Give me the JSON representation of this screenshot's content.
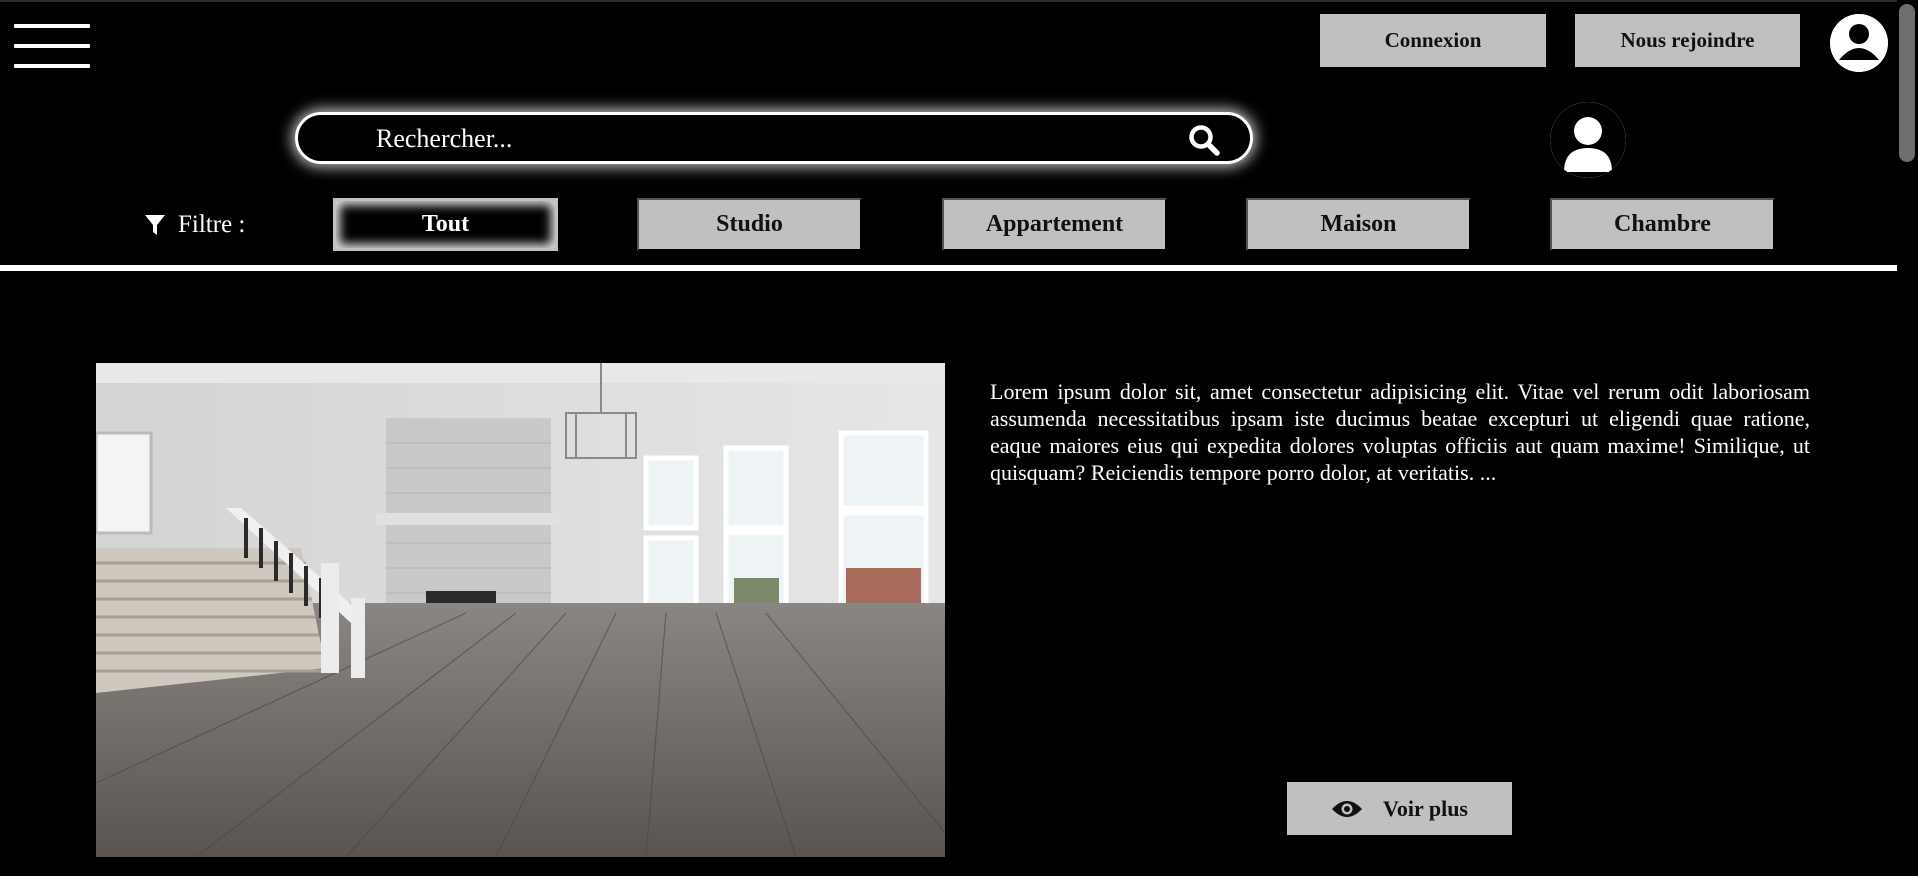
{
  "header": {
    "menu_icon": "hamburger-menu-icon",
    "login_label": "Connexion",
    "join_label": "Nous rejoindre",
    "account_icon": "user-avatar-icon"
  },
  "search": {
    "placeholder": "Rechercher...",
    "value": "",
    "icon": "search-icon",
    "profile_icon": "user-avatar-icon"
  },
  "filter": {
    "label": "Filtre :",
    "icon": "filter-funnel-icon",
    "options": [
      {
        "label": "Tout",
        "active": true
      },
      {
        "label": "Studio",
        "active": false
      },
      {
        "label": "Appartement",
        "active": false
      },
      {
        "label": "Maison",
        "active": false
      },
      {
        "label": "Chambre",
        "active": false
      }
    ]
  },
  "listing": {
    "photo_alt": "empty-living-room-photo",
    "description": "Lorem ipsum dolor sit, amet consectetur adipisicing elit. Vitae vel rerum odit laboriosam assumenda necessitatibus ipsam iste ducimus beatae excepturi ut eligendi quae ratione, eaque maiores eius qui expedita dolores voluptas officiis aut quam maxime! Similique, ut quisquam? Reiciendis tempore porro dolor, at veritatis. ...",
    "more_label": "Voir plus",
    "more_icon": "eye-icon"
  },
  "colors": {
    "background": "#000000",
    "button_gray": "#c0c0c0",
    "text": "#ffffff",
    "button_text": "#111111"
  }
}
